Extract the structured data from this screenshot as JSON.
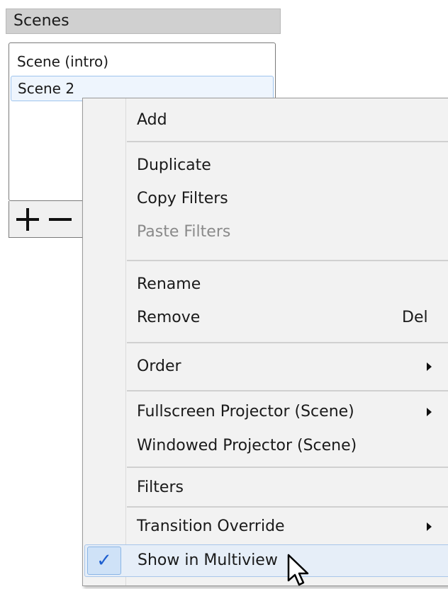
{
  "dock": {
    "title": "Scenes"
  },
  "scenes": {
    "items": [
      {
        "label": "Scene (intro)",
        "selected": false
      },
      {
        "label": "Scene 2",
        "selected": true
      }
    ],
    "toolbar": {
      "add_icon": "plus-icon",
      "remove_icon": "minus-icon"
    }
  },
  "context_menu": {
    "items": {
      "add": "Add",
      "duplicate": "Duplicate",
      "copy_filters": "Copy Filters",
      "paste_filters": "Paste Filters",
      "rename": "Rename",
      "remove": "Remove",
      "remove_shortcut": "Del",
      "order": "Order",
      "fullscreen_projector": "Fullscreen Projector (Scene)",
      "windowed_projector": "Windowed Projector (Scene)",
      "filters": "Filters",
      "transition_override": "Transition Override",
      "show_in_multiview": "Show in Multiview",
      "show_in_multiview_check": "✓"
    },
    "disabled": [
      "paste_filters"
    ],
    "checked": [
      "show_in_multiview"
    ],
    "submenus": [
      "order",
      "fullscreen_projector",
      "transition_override"
    ]
  },
  "colors": {
    "highlight_bg": "#e6eef8",
    "check_color": "#1e5fd0",
    "disabled_text": "#8a8a8a"
  }
}
